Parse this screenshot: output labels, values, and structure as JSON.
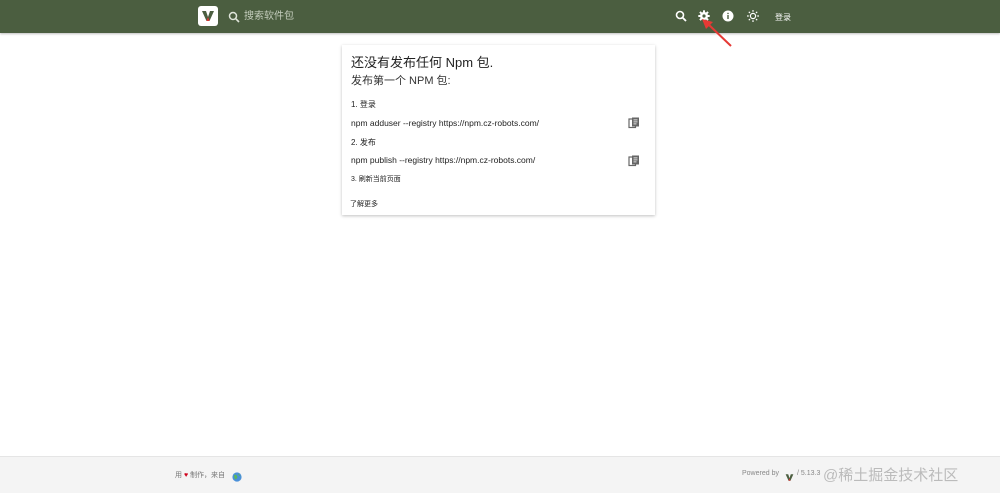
{
  "header": {
    "search_placeholder": "搜索软件包",
    "login_label": "登录",
    "icons": [
      "search-icon",
      "gear-icon",
      "info-icon",
      "theme-sun-icon"
    ],
    "bg_color": "#4b5e40"
  },
  "card": {
    "title": "还没有发布任何 Npm 包.",
    "subtitle": "发布第一个 NPM 包:",
    "steps": [
      {
        "label": "1. 登录",
        "command": "npm adduser --registry https://npm.cz-robots.com/"
      },
      {
        "label": "2. 发布",
        "command": "npm publish --registry https://npm.cz-robots.com/"
      },
      {
        "label": "3. 刷新当前页面"
      }
    ],
    "learn_more": "了解更多"
  },
  "footer": {
    "made_with_prefix": "用",
    "heart": "♥",
    "made_with_suffix": "制作，来自",
    "powered_by": "Powered by",
    "version": "/ 5.13.3",
    "watermark": "@稀土掘金技术社区"
  },
  "colors": {
    "annotation_arrow": "#e53935"
  }
}
